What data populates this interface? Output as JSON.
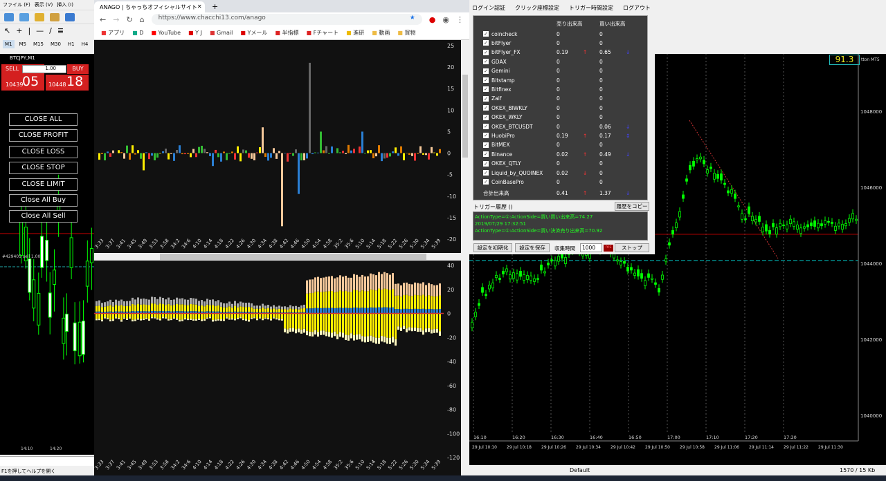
{
  "mt4": {
    "menu": [
      "ファイル (F)",
      "表示 (V)",
      "挿入 (I)"
    ],
    "timeframes": [
      "M1",
      "M5",
      "M15",
      "M30",
      "H1",
      "H4"
    ],
    "symbol": "BTCJPY,M1",
    "sell_label": "SELL",
    "buy_label": "BUY",
    "lot": "1.00",
    "sell_small": "10439",
    "sell_big": "05",
    "buy_small": "10448",
    "buy_big": "18",
    "close_buttons": [
      "CLOSE ALL",
      "CLOSE PROFIT",
      "CLOSE LOSS",
      "CLOSE STOP",
      "CLOSE LIMIT",
      "Close All Buy",
      "Close All Sell"
    ],
    "order_label": "#429405 sell 1.00",
    "time_labels": [
      "14:10",
      "14:20"
    ],
    "status": "F1を押してヘルプを開く",
    "colors": {
      "sell": "#d42020",
      "buy": "#d42020",
      "bull": "#00ff00"
    }
  },
  "browser": {
    "tab_title": "ANAGO | ちゃっちオフィシャルサイト",
    "url": "https://www.chacchi13.com/anago",
    "bookmarks": [
      "アプリ",
      "D",
      "YouTube",
      "Y J",
      "Gmail",
      "Yメール",
      "半指標",
      "Fチャート",
      "進研",
      "動画",
      "買物"
    ],
    "top_chart": {
      "y_ticks": [
        "25",
        "20",
        "15",
        "10",
        "5",
        "0",
        "-5",
        "-10",
        "-15",
        "-20"
      ]
    },
    "bottom_chart": {
      "y_ticks": [
        "40",
        "20",
        "0",
        "-20",
        "-40",
        "-60",
        "-80",
        "-100",
        "-120"
      ]
    },
    "x_ticks": [
      "3:33",
      "3:37",
      "3:41",
      "3:45",
      "3:49",
      "3:53",
      "3:58",
      "34:2",
      "34:6",
      "4:10",
      "4:14",
      "4:18",
      "4:22",
      "4:26",
      "4:30",
      "4:34",
      "4:38",
      "4:42",
      "4:46",
      "4:50",
      "4:54",
      "4:58",
      "35:2",
      "35:6",
      "5:10",
      "5:14",
      "5:18",
      "5:22",
      "5:26",
      "5:30",
      "5:34",
      "5:39"
    ]
  },
  "panel": {
    "menu": [
      "ログイン認証",
      "クリック座標設定",
      "トリガー時間設定",
      "ログアウト"
    ],
    "col_sell": "売り出来高",
    "col_buy": "買い出来高",
    "rows": [
      {
        "name": "coincheck",
        "sell": "0",
        "sa": "",
        "buy": "0",
        "ba": ""
      },
      {
        "name": "bitFlyer",
        "sell": "0",
        "sa": "",
        "buy": "0",
        "ba": ""
      },
      {
        "name": "bitFlyer_FX",
        "sell": "0.19",
        "sa": "↑",
        "buy": "0.65",
        "ba": "↓"
      },
      {
        "name": "GDAX",
        "sell": "0",
        "sa": "",
        "buy": "0",
        "ba": ""
      },
      {
        "name": "Gemini",
        "sell": "0",
        "sa": "",
        "buy": "0",
        "ba": ""
      },
      {
        "name": "Bitstamp",
        "sell": "0",
        "sa": "",
        "buy": "0",
        "ba": ""
      },
      {
        "name": "Bitfinex",
        "sell": "0",
        "sa": "",
        "buy": "0",
        "ba": ""
      },
      {
        "name": "Zaif",
        "sell": "0",
        "sa": "",
        "buy": "0",
        "ba": ""
      },
      {
        "name": "OKEX_BIWKLY",
        "sell": "0",
        "sa": "",
        "buy": "0",
        "ba": ""
      },
      {
        "name": "OKEX_WKLY",
        "sell": "0",
        "sa": "",
        "buy": "0",
        "ba": ""
      },
      {
        "name": "OKEX_BTCUSDT",
        "sell": "0",
        "sa": "",
        "buy": "0.06",
        "ba": "↓"
      },
      {
        "name": "HuobiPro",
        "sell": "0.19",
        "sa": "↑",
        "buy": "0.17",
        "ba": "↕"
      },
      {
        "name": "BitMEX",
        "sell": "0",
        "sa": "",
        "buy": "0",
        "ba": ""
      },
      {
        "name": "Binance",
        "sell": "0.02",
        "sa": "↑",
        "buy": "0.49",
        "ba": "↓"
      },
      {
        "name": "OKEX_QTLY",
        "sell": "0",
        "sa": "",
        "buy": "0",
        "ba": ""
      },
      {
        "name": "Liquid_by_QUOINEX",
        "sell": "0.02",
        "sa": "↓",
        "buy": "0",
        "ba": ""
      },
      {
        "name": "CoinBasePro",
        "sell": "0",
        "sa": "",
        "buy": "0",
        "ba": ""
      }
    ],
    "total": {
      "name": "合計出来高",
      "sell": "0.41",
      "sa": "↑",
      "buy": "1.37",
      "ba": "↓"
    },
    "history_label": "トリガー履歴 ()",
    "copy_label": "履歴をコピー",
    "history": [
      "ActionType=①:ActionSide=買い買い出来高=74.27",
      "2019/07/29 17:32:51",
      "ActionType=①:ActionSide=買い決済売り出来高=70.92"
    ],
    "reset_label": "設定を初期化",
    "save_label": "設定を保存",
    "interval_label": "収集時間",
    "interval_value": "1000",
    "unit": "ms",
    "stop_label": "ストップ"
  },
  "mt5": {
    "spread": "91.3",
    "broker": "tton MT5",
    "prices": [
      "1048000",
      "1046000",
      "1044000",
      "1042000",
      "1040000"
    ],
    "times": [
      "16:10",
      "16:20",
      "16:30",
      "16:40",
      "16:50",
      "17:00",
      "17:10",
      "17:20",
      "17:30"
    ],
    "dates": [
      "29 Jul 10:10",
      "29 Jul 10:18",
      "29 Jul 10:26",
      "29 Jul 10:34",
      "29 Jul 10:42",
      "29 Jul 10:50",
      "29 Jul 10:58",
      "29 Jul 11:06",
      "29 Jul 11:14",
      "29 Jul 11:22",
      "29 Jul 11:30"
    ],
    "profile": "Default",
    "traffic": "1570 / 15 Kb"
  }
}
